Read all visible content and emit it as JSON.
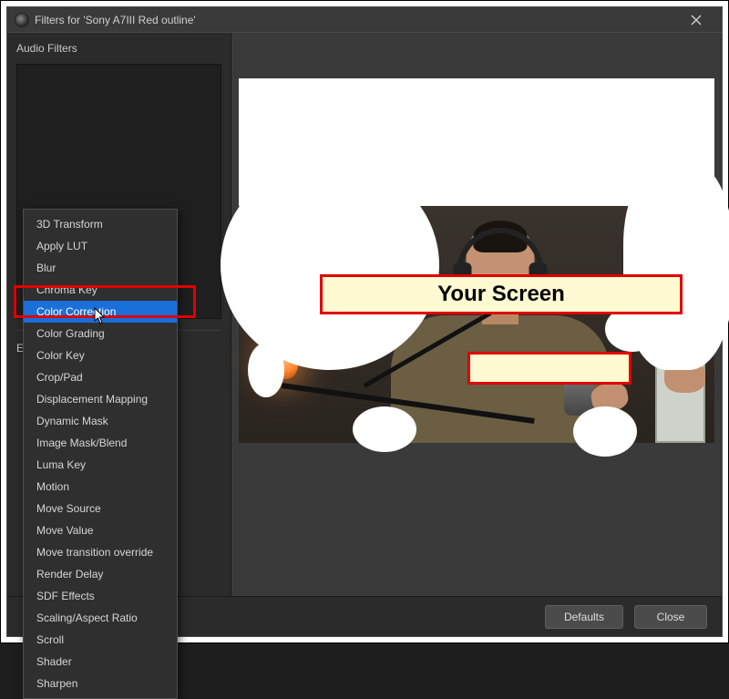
{
  "titlebar": {
    "title": "Filters for 'Sony A7III Red outline'"
  },
  "left": {
    "audio_filters_label": "Audio Filters",
    "effect_filters_hint": "E"
  },
  "context_menu": {
    "items": [
      "3D Transform",
      "Apply LUT",
      "Blur",
      "Chroma Key",
      "Color Correction",
      "Color Grading",
      "Color Key",
      "Crop/Pad",
      "Displacement Mapping",
      "Dynamic Mask",
      "Image Mask/Blend",
      "Luma Key",
      "Motion",
      "Move Source",
      "Move Value",
      "Move transition override",
      "Render Delay",
      "SDF Effects",
      "Scaling/Aspect Ratio",
      "Scroll",
      "Shader",
      "Sharpen"
    ],
    "hovered_index": 4
  },
  "footer": {
    "defaults": "Defaults",
    "close": "Close"
  },
  "annotations": {
    "your_screen": "Your Screen",
    "second": ""
  }
}
